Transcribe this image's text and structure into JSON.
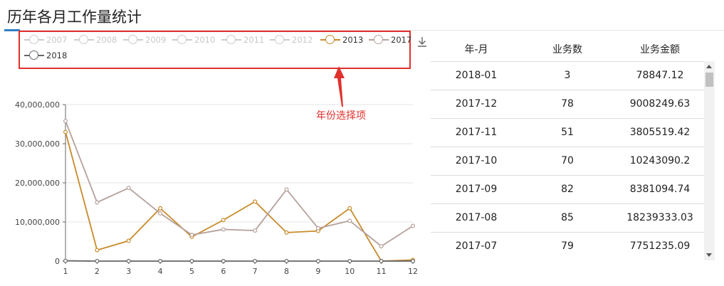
{
  "page": {
    "title": "历年各月工作量统计"
  },
  "annotation": {
    "text": "年份选择项"
  },
  "legend": {
    "items": [
      {
        "label": "2007",
        "color": "#cccccc",
        "active": false
      },
      {
        "label": "2008",
        "color": "#cccccc",
        "active": false
      },
      {
        "label": "2009",
        "color": "#cccccc",
        "active": false
      },
      {
        "label": "2010",
        "color": "#cccccc",
        "active": false
      },
      {
        "label": "2011",
        "color": "#cccccc",
        "active": false
      },
      {
        "label": "2012",
        "color": "#cccccc",
        "active": false
      },
      {
        "label": "2013",
        "color": "#c88a2a",
        "active": true
      },
      {
        "label": "2017",
        "color": "#b5a19c",
        "active": true
      },
      {
        "label": "2018",
        "color": "#666666",
        "active": true
      }
    ]
  },
  "icons": {
    "download": "download-icon"
  },
  "chart_data": {
    "type": "line",
    "x": [
      1,
      2,
      3,
      4,
      5,
      6,
      7,
      8,
      9,
      10,
      11,
      12
    ],
    "ylim": [
      0,
      40000000
    ],
    "yticks": [
      0,
      10000000,
      20000000,
      30000000,
      40000000
    ],
    "ytick_labels": [
      "0",
      "10,000,000",
      "20,000,000",
      "30,000,000",
      "40,000,000"
    ],
    "xtick_labels": [
      "1",
      "2",
      "3",
      "4",
      "5",
      "6",
      "7",
      "8",
      "9",
      "10",
      "11",
      "12"
    ],
    "grid": true,
    "series": [
      {
        "name": "2013",
        "color": "#c88a2a",
        "values": [
          33000000,
          2800000,
          5200000,
          13500000,
          6200000,
          10500000,
          15200000,
          7300000,
          7700000,
          13500000,
          0,
          300000
        ]
      },
      {
        "name": "2017",
        "color": "#b5a19c",
        "values": [
          35800000,
          15000000,
          18700000,
          12200000,
          6700000,
          8100000,
          7800000,
          18300000,
          8400000,
          10300000,
          3800000,
          9000000
        ]
      },
      {
        "name": "2018",
        "color": "#666666",
        "values": [
          78847.12,
          0,
          0,
          0,
          0,
          0,
          0,
          0,
          0,
          0,
          0,
          0
        ]
      }
    ]
  },
  "table": {
    "headers": [
      "年-月",
      "业务数",
      "业务金额"
    ],
    "rows": [
      [
        "2018-01",
        "3",
        "78847.12"
      ],
      [
        "2017-12",
        "78",
        "9008249.63"
      ],
      [
        "2017-11",
        "51",
        "3805519.42"
      ],
      [
        "2017-10",
        "70",
        "10243090.2"
      ],
      [
        "2017-09",
        "82",
        "8381094.74"
      ],
      [
        "2017-08",
        "85",
        "18239333.03"
      ],
      [
        "2017-07",
        "79",
        "7751235.09"
      ]
    ]
  }
}
